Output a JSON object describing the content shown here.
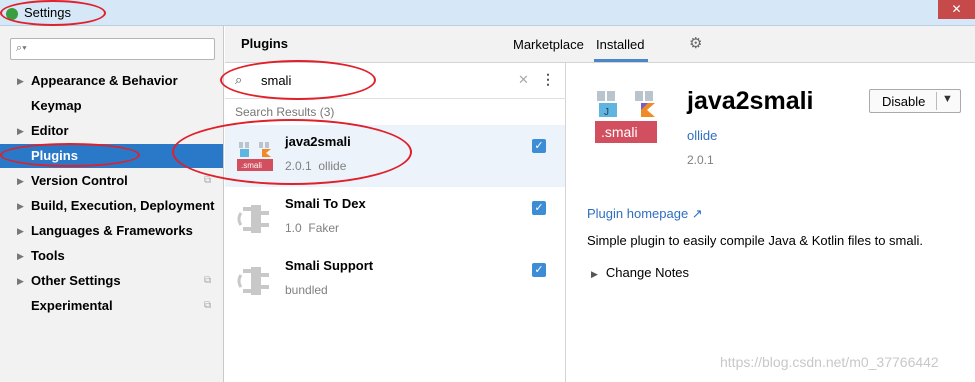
{
  "window": {
    "title": "Settings",
    "close_glyph": "✕"
  },
  "sidebar": {
    "search_placeholder": "",
    "items": [
      {
        "label": "Appearance & Behavior",
        "has_arrow": true
      },
      {
        "label": "Keymap",
        "has_arrow": false
      },
      {
        "label": "Editor",
        "has_arrow": true
      },
      {
        "label": "Plugins",
        "has_arrow": false,
        "selected": true
      },
      {
        "label": "Version Control",
        "has_arrow": true
      },
      {
        "label": "Build, Execution, Deployment",
        "has_arrow": true
      },
      {
        "label": "Languages & Frameworks",
        "has_arrow": true
      },
      {
        "label": "Tools",
        "has_arrow": true
      },
      {
        "label": "Other Settings",
        "has_arrow": true
      },
      {
        "label": "Experimental",
        "has_arrow": false
      }
    ]
  },
  "header": {
    "title": "Plugins",
    "tabs": [
      "Marketplace",
      "Installed"
    ],
    "active_tab": "Installed"
  },
  "plugin_search": {
    "value": "smali",
    "results_label": "Search Results (3)"
  },
  "plugins": [
    {
      "name": "java2smali",
      "version": "2.0.1",
      "vendor": "ollide",
      "enabled": true,
      "selected": true
    },
    {
      "name": "Smali To Dex",
      "version": "1.0",
      "vendor": "Faker",
      "enabled": true
    },
    {
      "name": "Smali Support",
      "version": "",
      "vendor": "bundled",
      "enabled": true
    }
  ],
  "detail": {
    "name": "java2smali",
    "vendor": "ollide",
    "version": "2.0.1",
    "disable_label": "Disable",
    "homepage_label": "Plugin homepage ↗",
    "description": "Simple plugin to easily compile Java & Kotlin files to smali.",
    "change_notes_label": "Change Notes",
    "icon_text": ".smali"
  },
  "watermark": "https://blog.csdn.net/m0_37766442",
  "colors": {
    "accent": "#2a78c8",
    "link": "#2f6ec1",
    "annotation": "#e0202a",
    "checkbox": "#3d8dd6"
  }
}
